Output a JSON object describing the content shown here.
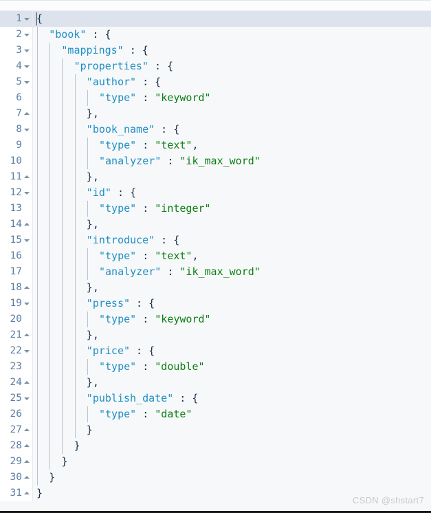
{
  "editor": {
    "language": "json",
    "active_line": 1,
    "colors": {
      "background": "#f7f8fa",
      "gutter_background": "#ffffff",
      "active_line": "#dde3ec",
      "key": "#1d8fc4",
      "value": "#0a8010",
      "punctuation": "#19324a",
      "line_number": "#5b7fa6",
      "indent_guide": "#b9c2cc"
    }
  },
  "watermark": {
    "text": "CSDN @shstart7"
  },
  "code": {
    "lines": [
      {
        "n": "1",
        "fold": "down",
        "indent": 0,
        "segments": [
          {
            "t": "{",
            "c": "p"
          }
        ]
      },
      {
        "n": "2",
        "fold": "down",
        "indent": 1,
        "segments": [
          {
            "t": "\"book\"",
            "c": "k"
          },
          {
            "t": " : {",
            "c": "p"
          }
        ]
      },
      {
        "n": "3",
        "fold": "down",
        "indent": 2,
        "segments": [
          {
            "t": "\"mappings\"",
            "c": "k"
          },
          {
            "t": " : {",
            "c": "p"
          }
        ]
      },
      {
        "n": "4",
        "fold": "down",
        "indent": 3,
        "segments": [
          {
            "t": "\"properties\"",
            "c": "k"
          },
          {
            "t": " : {",
            "c": "p"
          }
        ]
      },
      {
        "n": "5",
        "fold": "down",
        "indent": 4,
        "segments": [
          {
            "t": "\"author\"",
            "c": "k"
          },
          {
            "t": " : {",
            "c": "p"
          }
        ]
      },
      {
        "n": "6",
        "fold": "none",
        "indent": 5,
        "segments": [
          {
            "t": "\"type\"",
            "c": "k"
          },
          {
            "t": " : ",
            "c": "p"
          },
          {
            "t": "\"keyword\"",
            "c": "v"
          }
        ]
      },
      {
        "n": "7",
        "fold": "up",
        "indent": 4,
        "segments": [
          {
            "t": "},",
            "c": "p"
          }
        ]
      },
      {
        "n": "8",
        "fold": "down",
        "indent": 4,
        "segments": [
          {
            "t": "\"book_name\"",
            "c": "k"
          },
          {
            "t": " : {",
            "c": "p"
          }
        ]
      },
      {
        "n": "9",
        "fold": "none",
        "indent": 5,
        "segments": [
          {
            "t": "\"type\"",
            "c": "k"
          },
          {
            "t": " : ",
            "c": "p"
          },
          {
            "t": "\"text\"",
            "c": "v"
          },
          {
            "t": ",",
            "c": "p"
          }
        ]
      },
      {
        "n": "10",
        "fold": "none",
        "indent": 5,
        "segments": [
          {
            "t": "\"analyzer\"",
            "c": "k"
          },
          {
            "t": " : ",
            "c": "p"
          },
          {
            "t": "\"ik_max_word\"",
            "c": "v"
          }
        ]
      },
      {
        "n": "11",
        "fold": "up",
        "indent": 4,
        "segments": [
          {
            "t": "},",
            "c": "p"
          }
        ]
      },
      {
        "n": "12",
        "fold": "down",
        "indent": 4,
        "segments": [
          {
            "t": "\"id\"",
            "c": "k"
          },
          {
            "t": " : {",
            "c": "p"
          }
        ]
      },
      {
        "n": "13",
        "fold": "none",
        "indent": 5,
        "segments": [
          {
            "t": "\"type\"",
            "c": "k"
          },
          {
            "t": " : ",
            "c": "p"
          },
          {
            "t": "\"integer\"",
            "c": "v"
          }
        ]
      },
      {
        "n": "14",
        "fold": "up",
        "indent": 4,
        "segments": [
          {
            "t": "},",
            "c": "p"
          }
        ]
      },
      {
        "n": "15",
        "fold": "down",
        "indent": 4,
        "segments": [
          {
            "t": "\"introduce\"",
            "c": "k"
          },
          {
            "t": " : {",
            "c": "p"
          }
        ]
      },
      {
        "n": "16",
        "fold": "none",
        "indent": 5,
        "segments": [
          {
            "t": "\"type\"",
            "c": "k"
          },
          {
            "t": " : ",
            "c": "p"
          },
          {
            "t": "\"text\"",
            "c": "v"
          },
          {
            "t": ",",
            "c": "p"
          }
        ]
      },
      {
        "n": "17",
        "fold": "none",
        "indent": 5,
        "segments": [
          {
            "t": "\"analyzer\"",
            "c": "k"
          },
          {
            "t": " : ",
            "c": "p"
          },
          {
            "t": "\"ik_max_word\"",
            "c": "v"
          }
        ]
      },
      {
        "n": "18",
        "fold": "up",
        "indent": 4,
        "segments": [
          {
            "t": "},",
            "c": "p"
          }
        ]
      },
      {
        "n": "19",
        "fold": "down",
        "indent": 4,
        "segments": [
          {
            "t": "\"press\"",
            "c": "k"
          },
          {
            "t": " : {",
            "c": "p"
          }
        ]
      },
      {
        "n": "20",
        "fold": "none",
        "indent": 5,
        "segments": [
          {
            "t": "\"type\"",
            "c": "k"
          },
          {
            "t": " : ",
            "c": "p"
          },
          {
            "t": "\"keyword\"",
            "c": "v"
          }
        ]
      },
      {
        "n": "21",
        "fold": "up",
        "indent": 4,
        "segments": [
          {
            "t": "},",
            "c": "p"
          }
        ]
      },
      {
        "n": "22",
        "fold": "down",
        "indent": 4,
        "segments": [
          {
            "t": "\"price\"",
            "c": "k"
          },
          {
            "t": " : {",
            "c": "p"
          }
        ]
      },
      {
        "n": "23",
        "fold": "none",
        "indent": 5,
        "segments": [
          {
            "t": "\"type\"",
            "c": "k"
          },
          {
            "t": " : ",
            "c": "p"
          },
          {
            "t": "\"double\"",
            "c": "v"
          }
        ]
      },
      {
        "n": "24",
        "fold": "up",
        "indent": 4,
        "segments": [
          {
            "t": "},",
            "c": "p"
          }
        ]
      },
      {
        "n": "25",
        "fold": "down",
        "indent": 4,
        "segments": [
          {
            "t": "\"publish_date\"",
            "c": "k"
          },
          {
            "t": " : {",
            "c": "p"
          }
        ]
      },
      {
        "n": "26",
        "fold": "none",
        "indent": 5,
        "segments": [
          {
            "t": "\"type\"",
            "c": "k"
          },
          {
            "t": " : ",
            "c": "p"
          },
          {
            "t": "\"date\"",
            "c": "v"
          }
        ]
      },
      {
        "n": "27",
        "fold": "up",
        "indent": 4,
        "segments": [
          {
            "t": "}",
            "c": "p"
          }
        ]
      },
      {
        "n": "28",
        "fold": "up",
        "indent": 3,
        "segments": [
          {
            "t": "}",
            "c": "p"
          }
        ]
      },
      {
        "n": "29",
        "fold": "up",
        "indent": 2,
        "segments": [
          {
            "t": "}",
            "c": "p"
          }
        ]
      },
      {
        "n": "30",
        "fold": "up",
        "indent": 1,
        "segments": [
          {
            "t": "}",
            "c": "p"
          }
        ]
      },
      {
        "n": "31",
        "fold": "up",
        "indent": 0,
        "segments": [
          {
            "t": "}",
            "c": "p"
          }
        ]
      }
    ]
  }
}
